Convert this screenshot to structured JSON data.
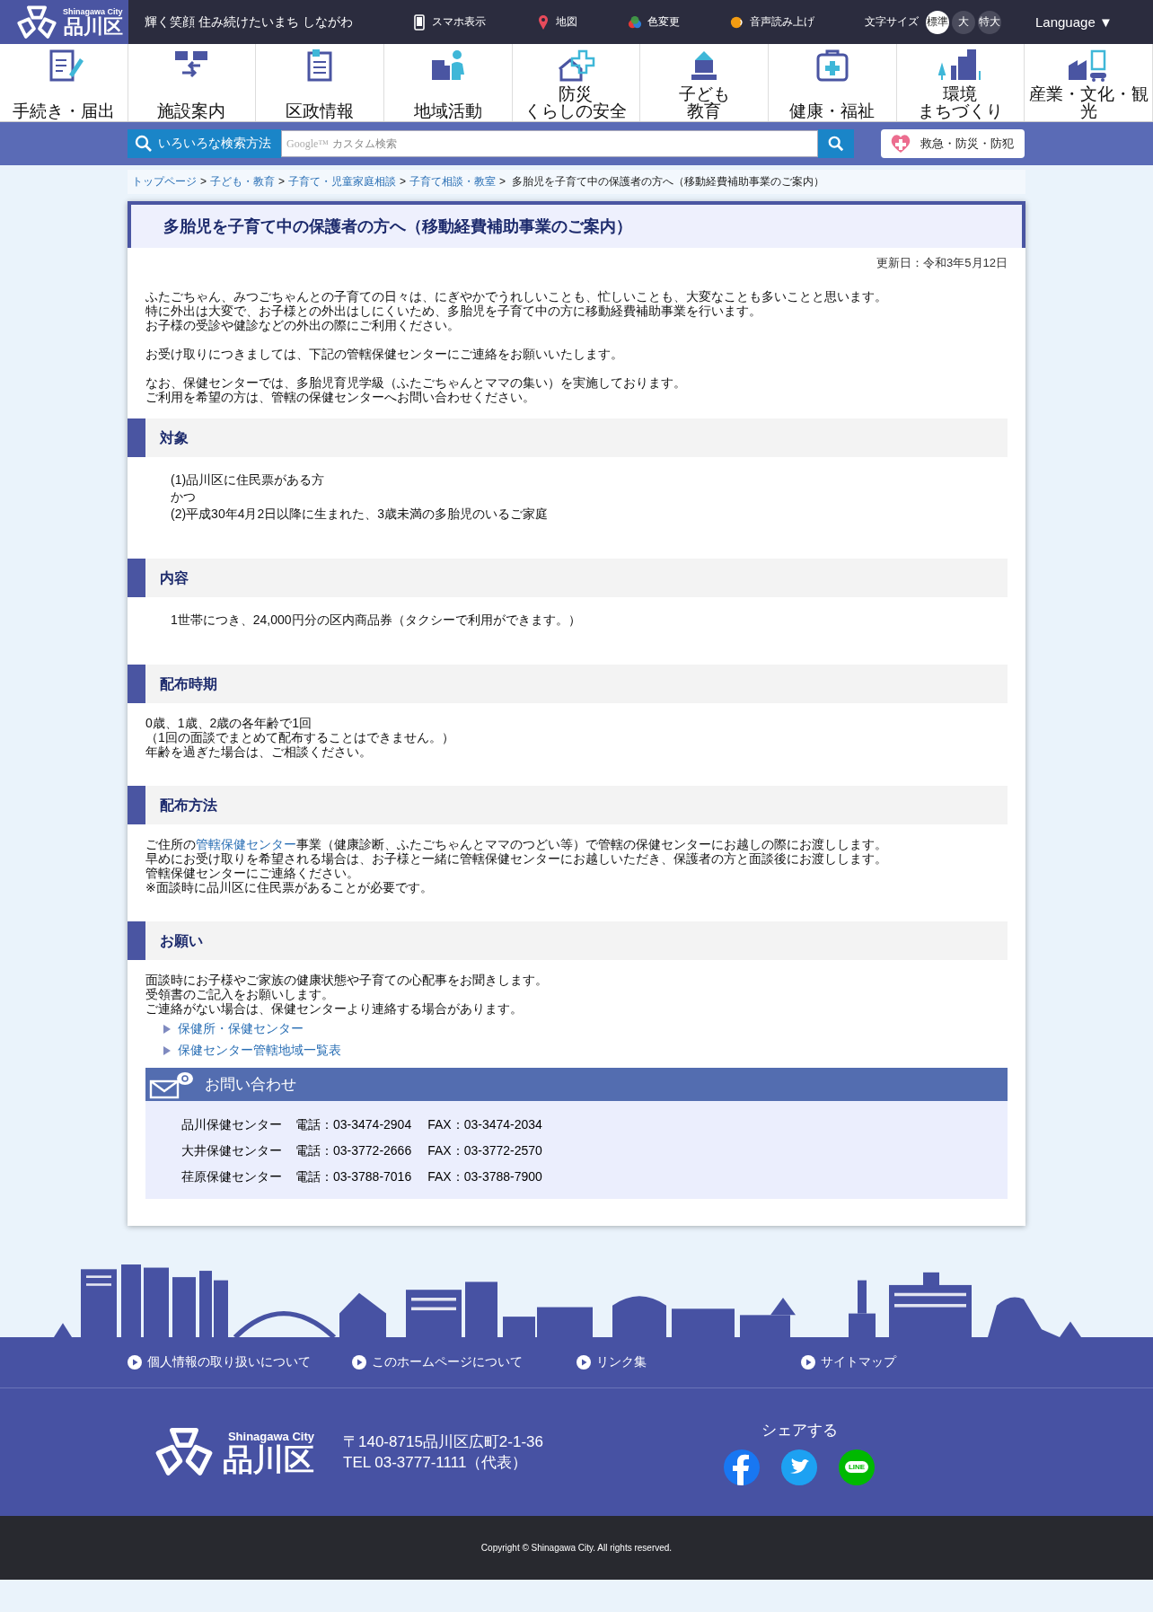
{
  "header": {
    "logo": {
      "en": "Shinagawa City",
      "ja": "品川区"
    },
    "tagline": "輝く笑顔 住み続けたいまち しながわ",
    "tools": [
      {
        "kind": "phone",
        "label": "スマホ表示"
      },
      {
        "kind": "pin",
        "label": "地図"
      },
      {
        "kind": "color",
        "label": "色変更"
      },
      {
        "kind": "audio",
        "label": "音声読み上げ"
      }
    ],
    "font_size": {
      "label": "文字サイズ",
      "options": [
        {
          "label": "標準",
          "selected": true
        },
        {
          "label": "大",
          "selected": false
        },
        {
          "label": "特大",
          "selected": false
        }
      ]
    },
    "language": {
      "label": "Language",
      "caret": "▼"
    }
  },
  "nav": [
    {
      "kind": "form",
      "lines": [
        "手続き・届出"
      ]
    },
    {
      "kind": "facility",
      "lines": [
        "施設案内"
      ]
    },
    {
      "kind": "document",
      "lines": [
        "区政情報"
      ]
    },
    {
      "kind": "community",
      "lines": [
        "地域活動"
      ]
    },
    {
      "kind": "safety",
      "lines": [
        "防災",
        "くらしの安全"
      ]
    },
    {
      "kind": "school",
      "lines": [
        "子ども",
        "教育"
      ]
    },
    {
      "kind": "health",
      "lines": [
        "健康・福祉"
      ]
    },
    {
      "kind": "city",
      "lines": [
        "環境",
        "まちづくり"
      ]
    },
    {
      "kind": "industry",
      "lines": [
        "産業・文化・観光"
      ]
    }
  ],
  "search": {
    "method_button": "いろいろな検索方法",
    "brand": "Google™",
    "placeholder": "カスタム検索",
    "emergency": "救急・防災・防犯"
  },
  "breadcrumb": {
    "links": [
      "トップページ",
      "子ども・教育",
      "子育て・児童家庭相談",
      "子育て相談・教室"
    ],
    "separator": ">",
    "current": "多胎児を子育て中の保護者の方へ（移動経費補助事業のご案内）"
  },
  "article": {
    "title": "多胎児を子育て中の保護者の方へ（移動経費補助事業のご案内）",
    "updated": "更新日：令和3年5月12日",
    "intro": [
      [
        "ふたごちゃん、みつごちゃんとの子育ての日々は、にぎやかでうれしいことも、忙しいことも、大変なことも多いことと思います。",
        "特に外出は大変で、お子様との外出はしにくいため、多胎児を子育て中の方に移動経費補助事業を行います。",
        "お子様の受診や健診などの外出の際にご利用ください。"
      ],
      [
        "お受け取りにつきましては、下記の管轄保健センターにご連絡をお願いいたします。"
      ],
      [
        "なお、保健センターでは、多胎児育児学級（ふたごちゃんとママの集い）を実施しております。",
        "ご利用を希望の方は、管轄の保健センターへお問い合わせください。"
      ]
    ],
    "sections": [
      {
        "heading": "対象",
        "indent": true,
        "lines": [
          {
            "text": "(1)品川区に住民票がある方"
          },
          {
            "text": "かつ"
          },
          {
            "text": "(2)平成30年4月2日以降に生まれた、3歳未満の多胎児のいるご家庭"
          }
        ]
      },
      {
        "heading": "内容",
        "indent": true,
        "lines": [
          {
            "text": "1世帯につき、24,000円分の区内商品券（タクシーで利用ができます。）"
          }
        ]
      },
      {
        "heading": "配布時期",
        "indent": false,
        "lines": [
          {
            "text": "0歳、1歳、2歳の各年齢で1回"
          },
          {
            "text": "（1回の面談でまとめて配布することはできません。）"
          },
          {
            "text": "年齢を過ぎた場合は、ご相談ください。"
          }
        ]
      },
      {
        "heading": "配布方法",
        "indent": false,
        "lines": [
          {
            "text": "ご住所の",
            "link": "管轄保健センター",
            "after": "事業（健康診断、ふたごちゃんとママのつどい等）で管轄の保健センターにお越しの際にお渡しします。"
          },
          {
            "text": "早めにお受け取りを希望される場合は、お子様と一緒に管轄保健センターにお越しいただき、保護者の方と面談後にお渡しします。"
          },
          {
            "text": "管轄保健センターにご連絡ください。"
          },
          {
            "text": "※面談時に品川区に住民票があることが必要です。"
          }
        ]
      },
      {
        "heading": "お願い",
        "indent": false,
        "lines": [
          {
            "text": "面談時にお子様やご家族の健康状態や子育ての心配事をお聞きします。"
          },
          {
            "text": "受領書のご記入をお願いします。"
          },
          {
            "text": "ご連絡がない場合は、保健センターより連絡する場合があります。"
          }
        ],
        "links": [
          "保健所・保健センター",
          "保健センター管轄地域一覧表"
        ]
      }
    ],
    "contact": {
      "title": "お問い合わせ",
      "rows": [
        {
          "name": "品川保健センター",
          "tel": "電話：03-3474-2904",
          "fax": "FAX：03-3474-2034"
        },
        {
          "name": "大井保健センター",
          "tel": "電話：03-3772-2666",
          "fax": "FAX：03-3772-2570"
        },
        {
          "name": "荏原保健センター",
          "tel": "電話：03-3788-7016",
          "fax": "FAX：03-3788-7900"
        }
      ]
    }
  },
  "footer": {
    "links": [
      "個人情報の取り扱いについて",
      "このホームページについて",
      "リンク集",
      "サイトマップ"
    ],
    "logo": {
      "en": "Shinagawa City",
      "ja": "品川区"
    },
    "address": [
      "〒140-8715品川区広町2-1-36",
      "TEL 03-3777-1111（代表）"
    ],
    "share": {
      "label": "シェアする",
      "items": [
        {
          "kind": "facebook"
        },
        {
          "kind": "twitter"
        },
        {
          "kind": "line",
          "label": "LINE"
        }
      ]
    },
    "copyright": "Copyright © Shinagawa City. All rights reserved."
  }
}
